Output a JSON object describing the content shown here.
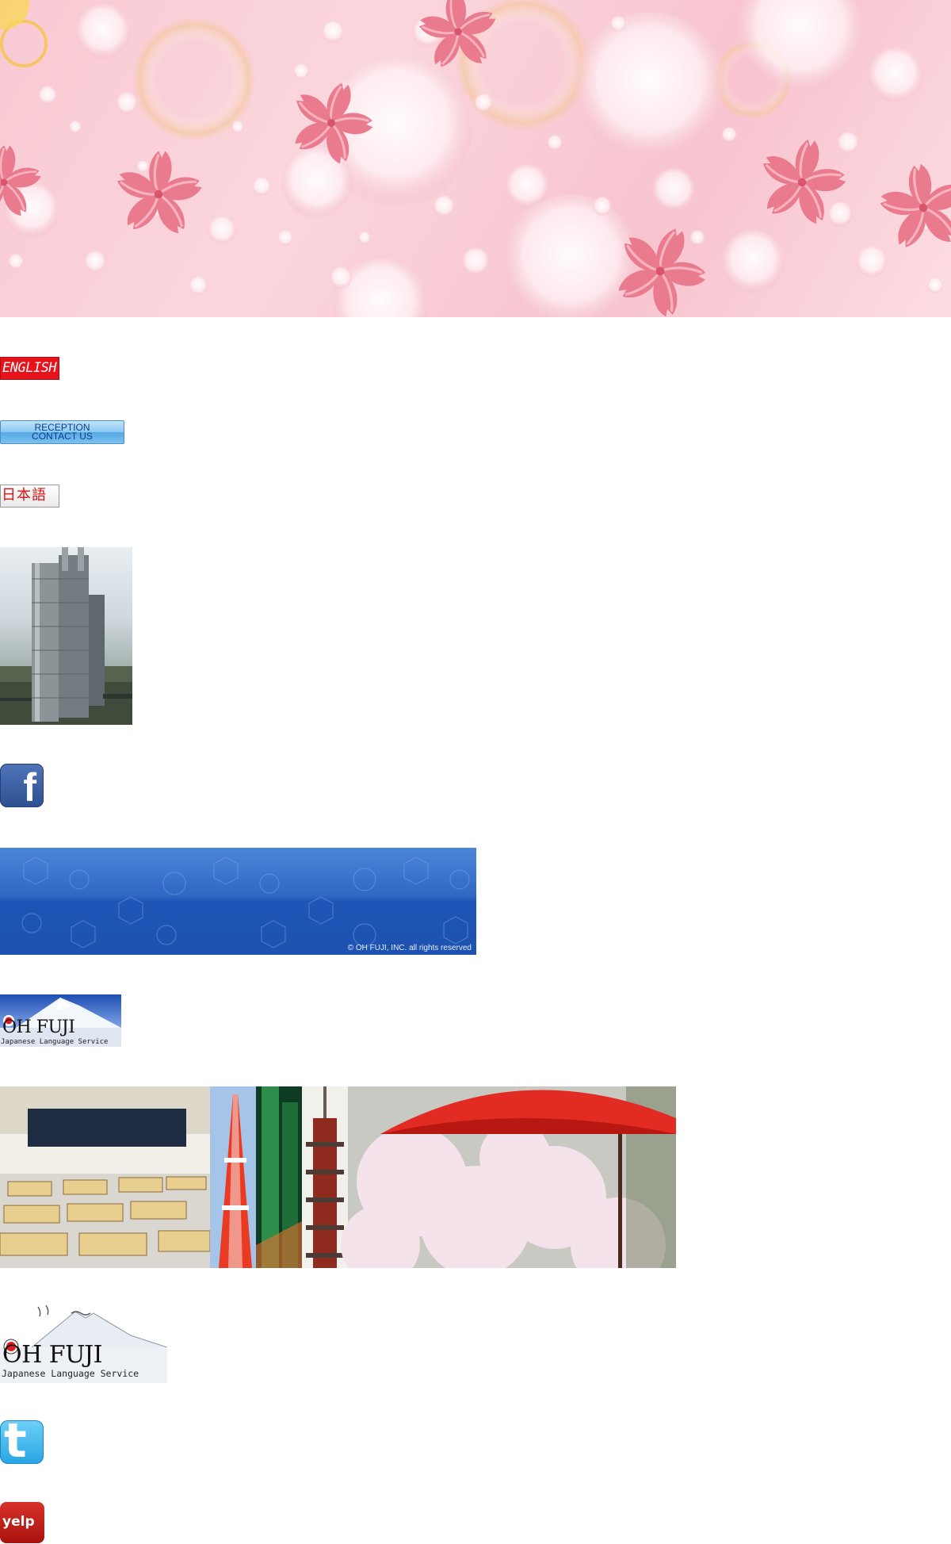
{
  "nav_buttons": {
    "english_label": "ENGLISH",
    "reception_line1": "RECEPTION",
    "reception_line2": "CONTACT US",
    "japanese_label": "日本語"
  },
  "banner": {
    "copyright": "© OH FUJI, INC. all rights reserved"
  },
  "logo": {
    "name": "OH FUJI",
    "tagline": "Japanese Language Service"
  },
  "social": {
    "facebook_glyph": "f",
    "twitter_glyph": "t",
    "yelp_label": "yelp"
  },
  "icons": {
    "facebook": "facebook-icon",
    "twitter": "twitter-icon",
    "yelp": "yelp-icon"
  },
  "colors": {
    "sakura_pink": "#e9738a",
    "english_red": "#e8121b",
    "reception_blue": "#7cc1f0",
    "banner_blue": "#2f67c4",
    "facebook_blue": "#3b5998",
    "twitter_blue": "#27a5e4",
    "yelp_red": "#c41200"
  }
}
